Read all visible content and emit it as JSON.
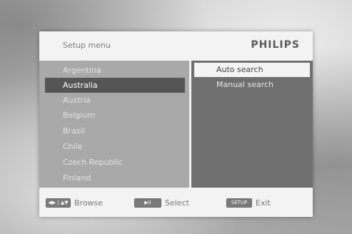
{
  "header": {
    "title": "Setup menu",
    "brand": "PHILIPS"
  },
  "countries": [
    {
      "label": "Argentina",
      "selected": false
    },
    {
      "label": "Australia",
      "selected": true
    },
    {
      "label": "Austria",
      "selected": false
    },
    {
      "label": "Belgium",
      "selected": false
    },
    {
      "label": "Brazil",
      "selected": false
    },
    {
      "label": "Chile",
      "selected": false
    },
    {
      "label": "Czech Republic",
      "selected": false
    },
    {
      "label": "Finland",
      "selected": false
    }
  ],
  "search_options": [
    {
      "label": "Auto search",
      "active": true
    },
    {
      "label": "Manual search",
      "active": false
    }
  ],
  "footer": {
    "browse": {
      "key": "◀▶ | ▲▼",
      "label": "Browse"
    },
    "select": {
      "key": "▶II",
      "label": "Select"
    },
    "exit": {
      "key": "SETUP",
      "label": "Exit"
    }
  }
}
